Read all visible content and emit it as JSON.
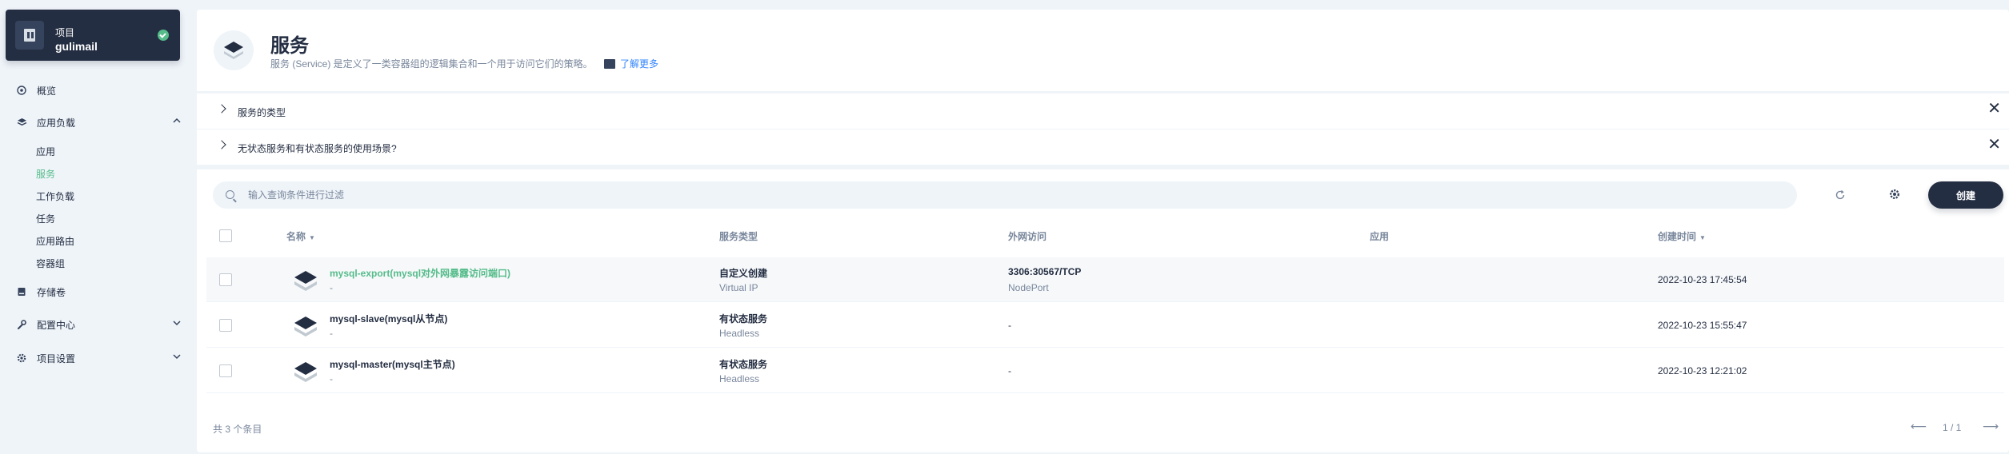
{
  "project": {
    "type_label": "项目",
    "name": "gulimail"
  },
  "sidebar": {
    "items": [
      {
        "label": "概览",
        "icon": "overview-icon"
      },
      {
        "label": "应用负载",
        "icon": "appworkload-icon"
      },
      {
        "label": "存储卷",
        "icon": "storage-icon"
      },
      {
        "label": "配置中心",
        "icon": "wrench-icon"
      },
      {
        "label": "项目设置",
        "icon": "settings-icon"
      }
    ],
    "subitems": [
      "应用",
      "服务",
      "工作负载",
      "任务",
      "应用路由",
      "容器组"
    ],
    "active_subitem": "服务"
  },
  "header": {
    "title": "服务",
    "description": "服务 (Service) 是定义了一类容器组的逻辑集合和一个用于访问它们的策略。",
    "learn_more": "了解更多"
  },
  "tips": [
    {
      "label": "服务的类型"
    },
    {
      "label": "无状态服务和有状态服务的使用场景?"
    }
  ],
  "toolbar": {
    "search_placeholder": "输入查询条件进行过滤",
    "create_label": "创建"
  },
  "table": {
    "columns": [
      "名称",
      "服务类型",
      "外网访问",
      "应用",
      "创建时间"
    ],
    "rows": [
      {
        "name": "mysql-export(mysql对外网暴露访问端口)",
        "desc": "-",
        "type": "自定义创建",
        "type_sub": "Virtual IP",
        "access": "3306:30567/TCP",
        "access_sub": "NodePort",
        "app": "",
        "created": "2022-10-23 17:45:54"
      },
      {
        "name": "mysql-slave(mysql从节点)",
        "desc": "-",
        "type": "有状态服务",
        "type_sub": "Headless",
        "access": "-",
        "access_sub": "",
        "app": "",
        "created": "2022-10-23 15:55:47"
      },
      {
        "name": "mysql-master(mysql主节点)",
        "desc": "-",
        "type": "有状态服务",
        "type_sub": "Headless",
        "access": "-",
        "access_sub": "",
        "app": "",
        "created": "2022-10-23 12:21:02"
      }
    ]
  },
  "footer": {
    "total": "共 3 个条目",
    "page": "1 / 1"
  },
  "colors": {
    "accent": "#55bc8a",
    "dark": "#242e42",
    "muted": "#79879c",
    "bg": "#eff4f9"
  }
}
